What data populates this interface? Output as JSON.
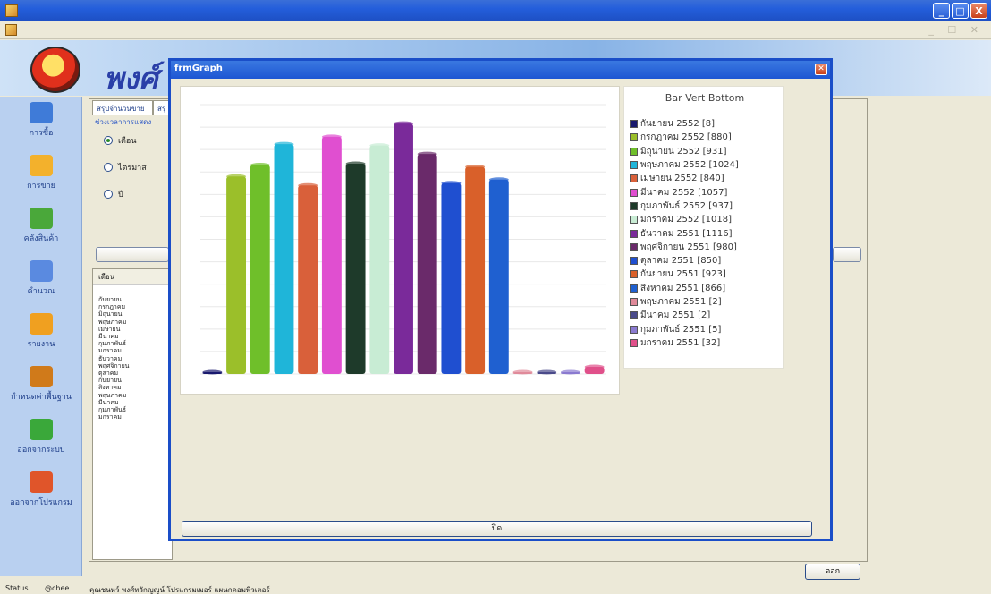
{
  "app": {
    "main_buttons": [
      "_",
      "□",
      "X"
    ]
  },
  "sidebar": {
    "items": [
      {
        "label": "การซื้อ",
        "color": "#3f7bd8"
      },
      {
        "label": "การขาย",
        "color": "#f3b12c"
      },
      {
        "label": "คลังสินค้า",
        "color": "#4aa83a"
      },
      {
        "label": "คำนวณ",
        "color": "#5a8ae0"
      },
      {
        "label": "รายงาน",
        "color": "#f0a020"
      },
      {
        "label": "กำหนดค่าพื้นฐาน",
        "color": "#d07a1a"
      },
      {
        "label": "ออกจากระบบ",
        "color": "#3aa83a"
      },
      {
        "label": "ออกจากโปรแกรม",
        "color": "#e0552a"
      }
    ]
  },
  "form": {
    "tabs": [
      "สรุปจำนวนขาย",
      "สรุ"
    ],
    "group_caption": "ช่วงเวลาการแสดง",
    "radios": [
      {
        "label": "เดือน",
        "selected": true
      },
      {
        "label": "ไตรมาส",
        "selected": false
      },
      {
        "label": "ปี",
        "selected": false
      }
    ],
    "grid_header": "เดือน",
    "grid_rows": [
      "กันยายน",
      "กรกฎาคม",
      "มิถุนายน",
      "พฤษภาคม",
      "เมษายน",
      "มีนาคม",
      "กุมภาพันธ์",
      "มกราคม",
      "ธันวาคม",
      "พฤศจิกายน",
      "ตุลาคม",
      "กันยายน",
      "สิงหาคม",
      "พฤษภาคม",
      "มีนาคม",
      "กุมภาพันธ์",
      "มกราคม"
    ],
    "exit_label": "ออก"
  },
  "dialog": {
    "title": "frmGraph",
    "close_label": "ปิด"
  },
  "chart_data": {
    "type": "bar",
    "title": "Bar Vert Bottom",
    "xlabel": "",
    "ylabel": "",
    "grid": true,
    "legend": "right",
    "ylim": [
      0,
      1200
    ],
    "categories": [
      "กันยายน 2552",
      "กรกฎาคม 2552",
      "มิถุนายน 2552",
      "พฤษภาคม 2552",
      "เมษายน 2552",
      "มีนาคม 2552",
      "กุมภาพันธ์ 2552",
      "มกราคม 2552",
      "ธันวาคม 2551",
      "พฤศจิกายน 2551",
      "ตุลาคม 2551",
      "กันยายน 2551",
      "สิงหาคม 2551",
      "พฤษภาคม 2551",
      "มีนาคม 2551",
      "กุมภาพันธ์ 2551",
      "มกราคม 2551"
    ],
    "values": [
      8,
      880,
      931,
      1024,
      840,
      1057,
      937,
      1018,
      1116,
      980,
      850,
      923,
      866,
      2,
      2,
      5,
      32
    ],
    "colors": [
      "#1a1a6e",
      "#9bbf2a",
      "#6fbf2a",
      "#1fb5d9",
      "#d9603a",
      "#e04fd0",
      "#1e3a2a",
      "#c8ecd4",
      "#7a2a9a",
      "#6a2a6a",
      "#1f4fd0",
      "#d9602a",
      "#1f60d0",
      "#e08a9a",
      "#4a4a8a",
      "#8a7ad0",
      "#e0508a"
    ],
    "legend_entries": [
      "กันยายน 2552 [8]",
      "กรกฎาคม 2552 [880]",
      "มิถุนายน 2552 [931]",
      "พฤษภาคม 2552 [1024]",
      "เมษายน 2552 [840]",
      "มีนาคม 2552 [1057]",
      "กุมภาพันธ์ 2552 [937]",
      "มกราคม 2552 [1018]",
      "ธันวาคม 2551 [1116]",
      "พฤศจิกายน 2551 [980]",
      "ตุลาคม 2551 [850]",
      "กันยายน 2551 [923]",
      "สิงหาคม 2551 [866]",
      "พฤษภาคม 2551 [2]",
      "มีนาคม 2551 [2]",
      "กุมภาพันธ์ 2551 [5]",
      "มกราคม 2551 [32]"
    ]
  },
  "statusbar": {
    "status": "Status",
    "user": "@chee",
    "developer": "คุณชนหว์ พงศ์หวักญญน์ โปรแกรมเมอร์ แผนกคอมพิวเตอร์"
  }
}
